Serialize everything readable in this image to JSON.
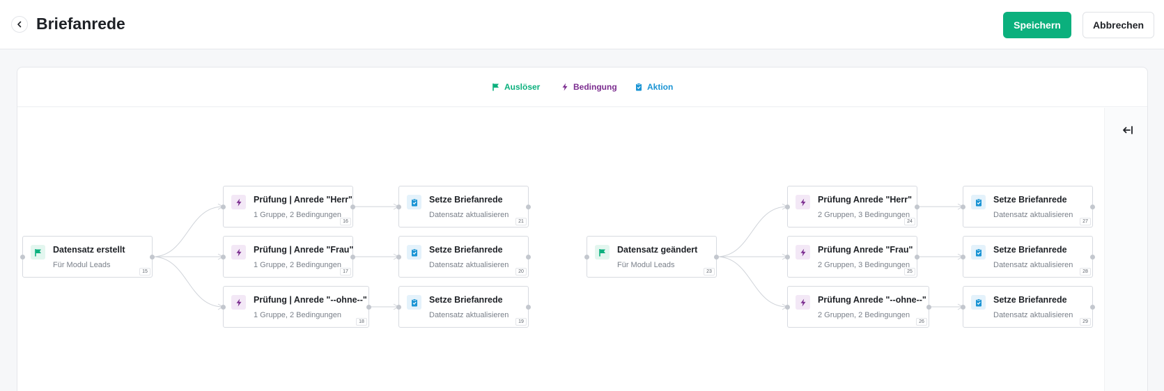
{
  "header": {
    "title": "Briefanrede",
    "save_label": "Speichern",
    "cancel_label": "Abbrechen"
  },
  "legend": {
    "trigger": "Auslöser",
    "condition": "Bedingung",
    "action": "Aktion"
  },
  "colors": {
    "trigger": "#0bb07d",
    "condition": "#7b2c8f",
    "action": "#1a94d4"
  },
  "nodes": {
    "n15": {
      "type": "trigger",
      "title": "Datensatz erstellt",
      "subtitle": "Für Modul Leads",
      "id": "15"
    },
    "n16": {
      "type": "condition",
      "title": "Prüfung | Anrede \"Herr\"",
      "subtitle": "1 Gruppe, 2 Bedingungen",
      "id": "16"
    },
    "n17": {
      "type": "condition",
      "title": "Prüfung | Anrede \"Frau\"",
      "subtitle": "1 Gruppe, 2 Bedingungen",
      "id": "17"
    },
    "n18": {
      "type": "condition",
      "title": "Prüfung | Anrede \"--ohne--\"",
      "subtitle": "1 Gruppe, 2 Bedingungen",
      "id": "18"
    },
    "n21": {
      "type": "action",
      "title": "Setze Briefanrede",
      "subtitle": "Datensatz aktualisieren",
      "id": "21"
    },
    "n20": {
      "type": "action",
      "title": "Setze Briefanrede",
      "subtitle": "Datensatz aktualisieren",
      "id": "20"
    },
    "n19": {
      "type": "action",
      "title": "Setze Briefanrede",
      "subtitle": "Datensatz aktualisieren",
      "id": "19"
    },
    "n23": {
      "type": "trigger",
      "title": "Datensatz geändert",
      "subtitle": "Für Modul Leads",
      "id": "23"
    },
    "n24": {
      "type": "condition",
      "title": "Prüfung Anrede \"Herr\"",
      "subtitle": "2 Gruppen, 3 Bedingungen",
      "id": "24"
    },
    "n25": {
      "type": "condition",
      "title": "Prüfung Anrede \"Frau\"",
      "subtitle": "2 Gruppen, 3 Bedingungen",
      "id": "25"
    },
    "n26": {
      "type": "condition",
      "title": "Prüfung Anrede \"--ohne--\"",
      "subtitle": "2 Gruppen, 2 Bedingungen",
      "id": "26"
    },
    "n27": {
      "type": "action",
      "title": "Setze Briefanrede",
      "subtitle": "Datensatz aktualisieren",
      "id": "27"
    },
    "n28": {
      "type": "action",
      "title": "Setze Briefanrede",
      "subtitle": "Datensatz aktualisieren",
      "id": "28"
    },
    "n29": {
      "type": "action",
      "title": "Setze Briefanrede",
      "subtitle": "Datensatz aktualisieren",
      "id": "29"
    }
  },
  "edges": [
    [
      "n15",
      "n16"
    ],
    [
      "n15",
      "n17"
    ],
    [
      "n15",
      "n18"
    ],
    [
      "n16",
      "n21"
    ],
    [
      "n17",
      "n20"
    ],
    [
      "n18",
      "n19"
    ],
    [
      "n23",
      "n24"
    ],
    [
      "n23",
      "n25"
    ],
    [
      "n23",
      "n26"
    ],
    [
      "n24",
      "n27"
    ],
    [
      "n25",
      "n28"
    ],
    [
      "n26",
      "n29"
    ]
  ],
  "icons": {
    "trigger": "flag-icon",
    "condition": "lightning-icon",
    "action": "clipboard-check-icon",
    "back": "chevron-left-icon",
    "collapse": "arrow-left-to-line-icon"
  }
}
